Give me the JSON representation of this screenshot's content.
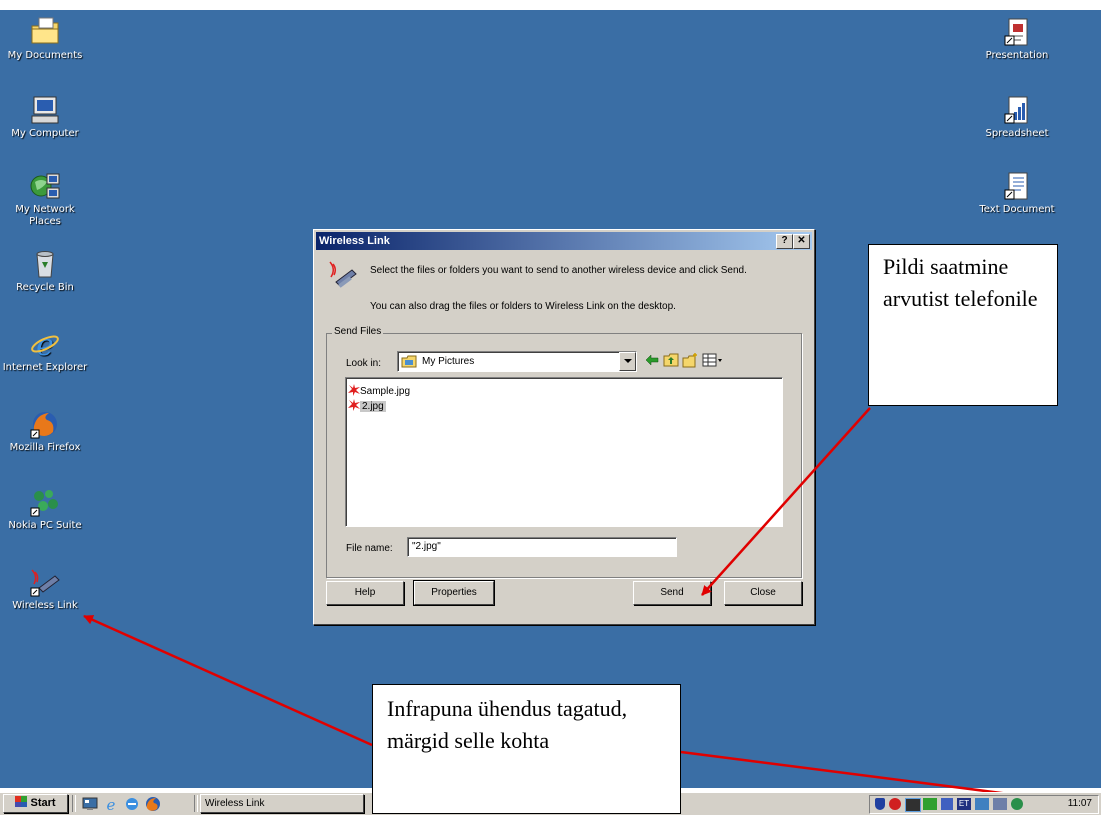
{
  "desktop": {
    "left_icons": [
      {
        "label": "My Documents",
        "icon": "folder-icon"
      },
      {
        "label": "My Computer",
        "icon": "computer-icon"
      },
      {
        "label": "My Network Places",
        "icon": "network-icon"
      },
      {
        "label": "Recycle Bin",
        "icon": "recycle-bin-icon"
      },
      {
        "label": "Internet Explorer",
        "icon": "ie-icon"
      },
      {
        "label": "Mozilla Firefox",
        "icon": "firefox-icon"
      },
      {
        "label": "Nokia PC Suite",
        "icon": "nokia-icon"
      },
      {
        "label": "Wireless Link",
        "icon": "wireless-link-icon"
      }
    ],
    "right_icons": [
      {
        "label": "Presentation",
        "icon": "presentation-shortcut-icon"
      },
      {
        "label": "Spreadsheet",
        "icon": "spreadsheet-shortcut-icon"
      },
      {
        "label": "Text Document",
        "icon": "text-document-shortcut-icon"
      }
    ]
  },
  "dialog": {
    "title": "Wireless Link",
    "help_glyph": "?",
    "close_glyph": "✕",
    "intro_line1": "Select the files or folders you want to send to another wireless device and click Send.",
    "intro_line2": "You can also drag the files or folders to Wireless Link on the desktop.",
    "group_label": "Send Files",
    "look_in_label": "Look in:",
    "look_in_value": "My Pictures",
    "files": [
      {
        "name": "Sample.jpg",
        "selected": false
      },
      {
        "name": "2.jpg",
        "selected": true
      }
    ],
    "file_name_label": "File name:",
    "file_name_value": "\"2.jpg\"",
    "buttons": {
      "help": "Help",
      "properties": "Properties",
      "send": "Send",
      "close": "Close"
    }
  },
  "callouts": {
    "send_note": "Pildi saatmine arvutist telefonile",
    "infrared_note": "Infrapuna ühendus tagatud, märgid selle kohta"
  },
  "taskbar": {
    "start_label": "Start",
    "window_button": "Wireless Link",
    "clock": "11:07",
    "tray_lang": "ET"
  },
  "colors": {
    "desktop": "#3a6ea5",
    "titlebar": "#0a246a",
    "arrow": "#e00000"
  }
}
